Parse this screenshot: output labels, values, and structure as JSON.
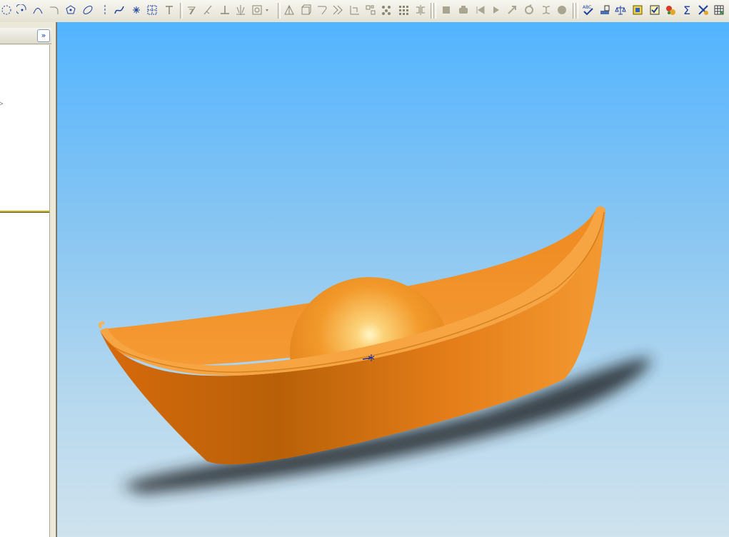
{
  "toolbar": {
    "groups": [
      {
        "name": "sketch-tools",
        "icons": [
          "dotted-circle-icon",
          "tangent-arc-icon",
          "three-point-arc-icon",
          "fillet-arc-icon",
          "polygon-icon",
          "ellipse-icon",
          "centerline-icon",
          "spline-icon",
          "point-icon",
          "sketch-grid-icon",
          "text-icon"
        ]
      },
      {
        "name": "sketch-entities",
        "icons": [
          "offset-icon",
          "trim-icon",
          "perpendicular-icon",
          "mirror-entities-icon",
          "pattern-dropdown-icon"
        ]
      },
      {
        "name": "features",
        "icons": [
          "draft-icon",
          "shell-icon",
          "fillet-feature-icon",
          "linear-pattern-icon",
          "circular-pattern-icon",
          "fill-pattern-icon",
          "hole-pattern-icon",
          "table-pattern-icon",
          "mirror-feature-icon"
        ]
      },
      {
        "name": "animation",
        "icons": [
          "stop-icon",
          "record-icon",
          "rewind-icon",
          "play-icon",
          "explode-icon",
          "rotate-icon",
          "collapse-icon",
          "capture-icon"
        ]
      },
      {
        "name": "tools",
        "icons": [
          "spell-check-icon",
          "measure-icon",
          "mass-properties-icon",
          "section-icon",
          "check-icon",
          "materials-icon",
          "equations-icon",
          "quick-snaps-icon",
          "table-icon"
        ]
      }
    ],
    "spell_check_label": "ABC"
  },
  "left_panel": {
    "expand_label": "»",
    "tree_arrow": "▷"
  },
  "viewport": {
    "background_top": "#52b4ff",
    "background_bottom": "#cfe2ee",
    "model_color": "#f2891c",
    "shadow_color": "#2a2f33"
  }
}
